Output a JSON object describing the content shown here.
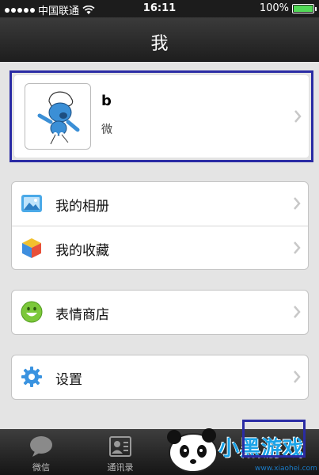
{
  "status_bar": {
    "carrier": "中国联通",
    "time": "16:11",
    "battery_percent": "100%"
  },
  "nav": {
    "title": "我"
  },
  "profile": {
    "name": "b",
    "subtitle": "微"
  },
  "menu_groups": [
    [
      {
        "label": "我的相册",
        "icon": "photo-album-icon"
      },
      {
        "label": "我的收藏",
        "icon": "favorites-cube-icon"
      }
    ],
    [
      {
        "label": "表情商店",
        "icon": "smiley-face-icon"
      }
    ],
    [
      {
        "label": "设置",
        "icon": "settings-gear-icon"
      }
    ]
  ],
  "tabs": [
    {
      "label": "微信",
      "icon": "chat-bubble-icon"
    },
    {
      "label": "通讯录",
      "icon": "contacts-card-icon"
    }
  ],
  "watermark": {
    "text": "小黑游戏",
    "url": "www.xiaohei.com"
  },
  "colors": {
    "highlight": "#2a2ba4",
    "battery": "#52d957",
    "accent": "#1aa3e8"
  }
}
